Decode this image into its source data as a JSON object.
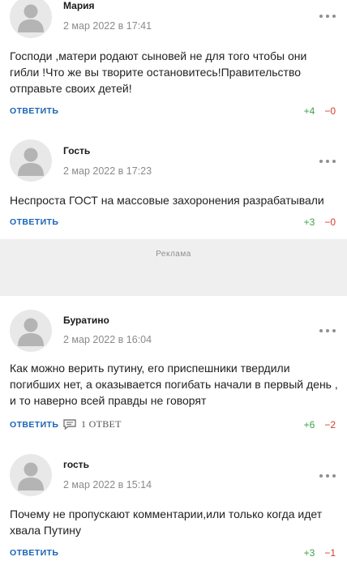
{
  "comments": [
    {
      "author": "Мария",
      "date": "2 мар 2022 в 17:41",
      "text": "Господи ,матери родают сыновей не для того чтобы они гибли !Что же вы творите остановитесь!Правительство отправьте своих детей!",
      "reply_label": "ОТВЕТИТЬ",
      "up": "+4",
      "down": "−0"
    },
    {
      "author": "Гость",
      "date": "2 мар 2022 в 17:23",
      "text": "Неспроста ГОСТ на массовые захоронения разрабатывали",
      "reply_label": "ОТВЕТИТЬ",
      "up": "+3",
      "down": "−0"
    },
    {
      "author": "Буратино",
      "date": "2 мар 2022 в 16:04",
      "text": "Как можно верить путину, его приспешники твердили погибших нет, а оказывается погибать начали в первый день , и то наверно всей правды не говорят",
      "reply_label": "ОТВЕТИТЬ",
      "replies_label": "1 ОТВЕТ",
      "up": "+6",
      "down": "−2"
    },
    {
      "author": "гость",
      "date": "2 мар 2022 в 15:14",
      "text": "Почему не пропускают комментарии,или только когда идет хвала Путину",
      "reply_label": "ОТВЕТИТЬ",
      "up": "+3",
      "down": "−1"
    }
  ],
  "ad": {
    "label": "Реклама"
  },
  "icons": {
    "avatar": "user-avatar-icon",
    "more": "more-dots-icon",
    "replies": "comment-bubble-icon"
  },
  "colors": {
    "reply_link": "#1a63b5",
    "vote_up": "#3ca34a",
    "vote_down": "#d43a2f",
    "ad_background": "#efefef"
  }
}
